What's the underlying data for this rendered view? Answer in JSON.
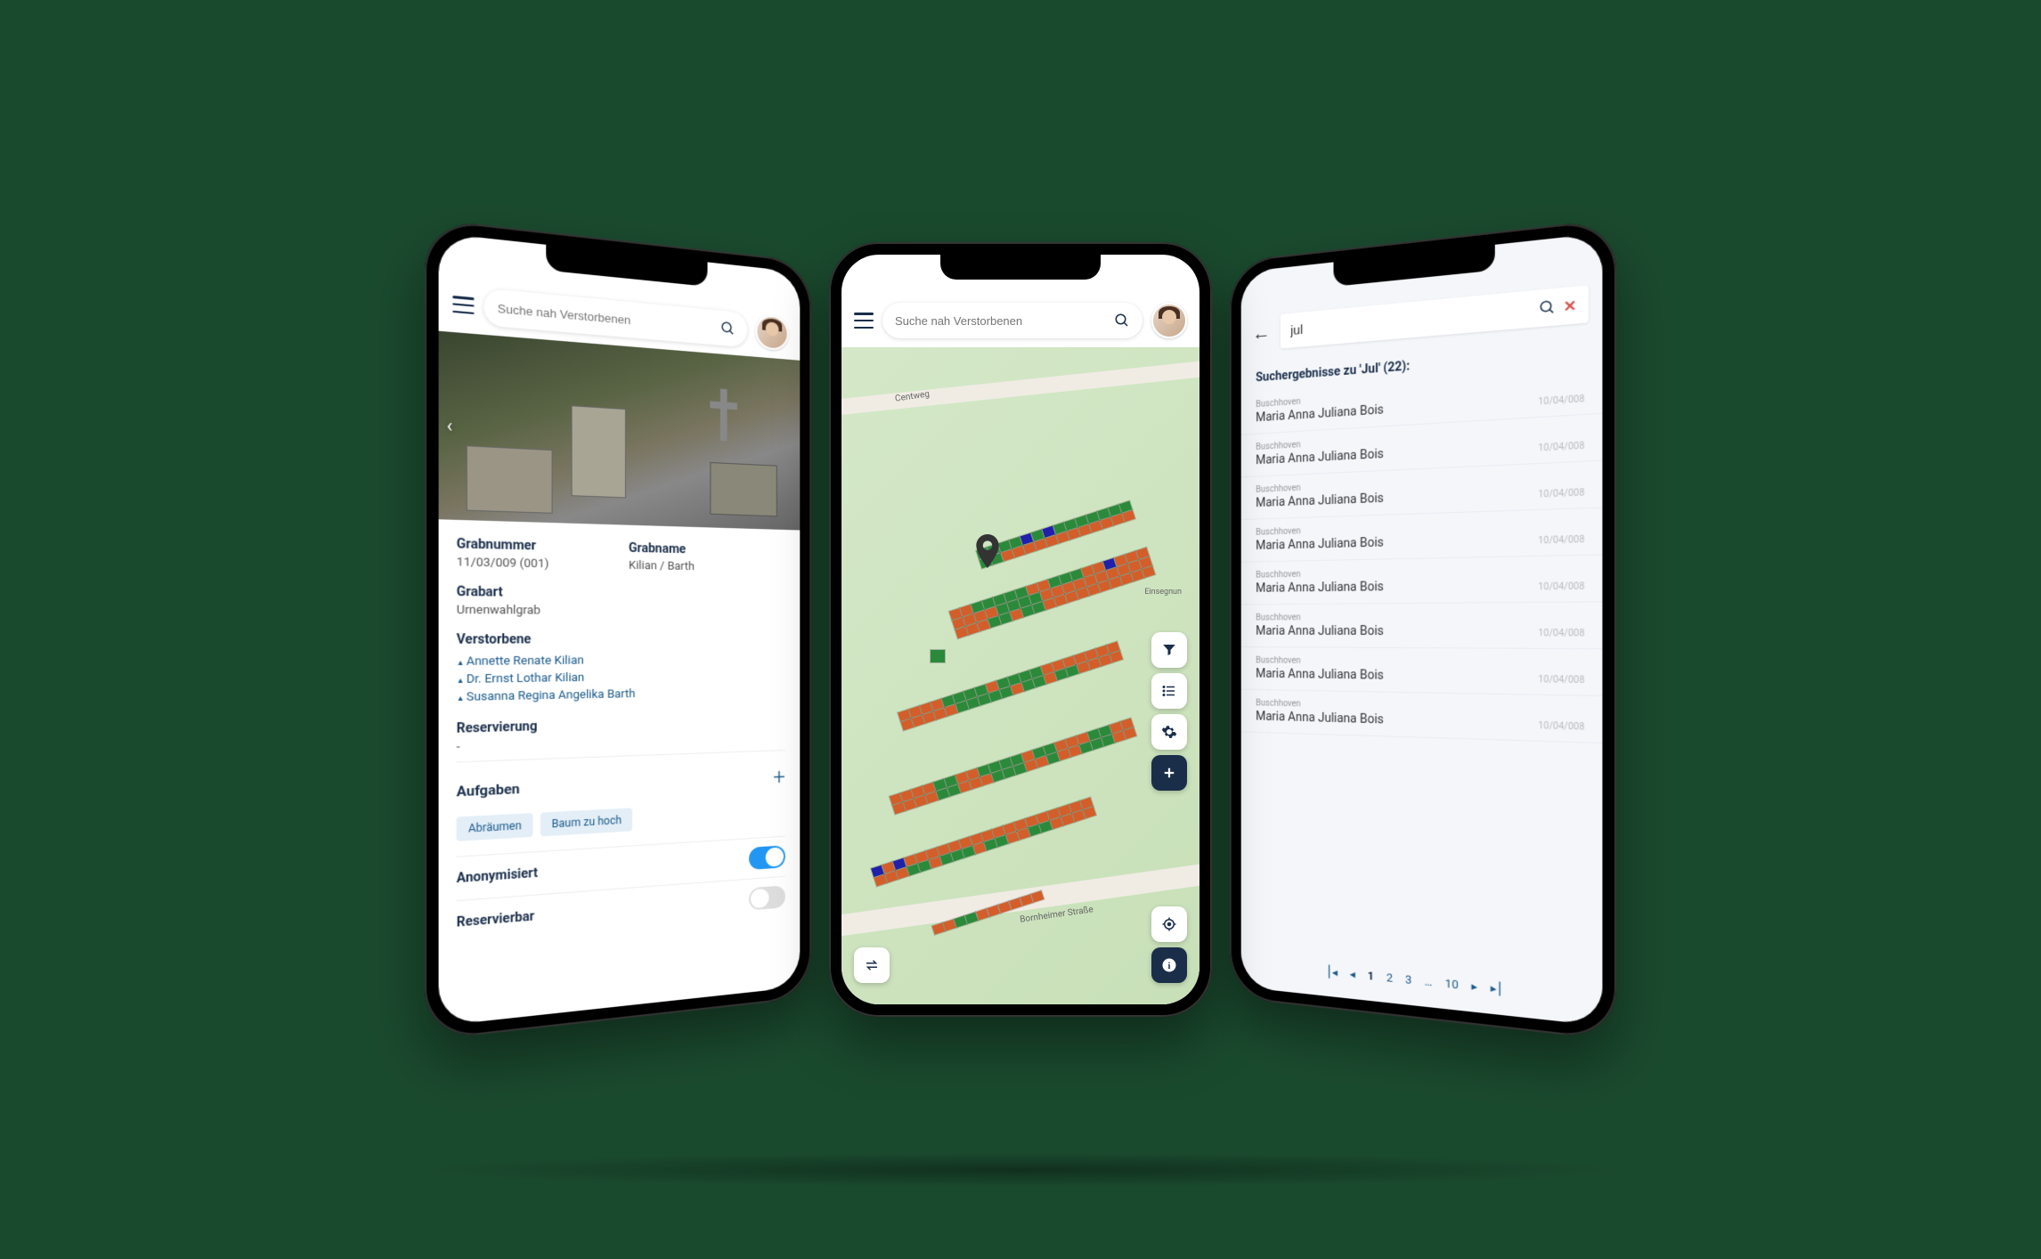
{
  "search_placeholder": "Suche nah Verstorbenen",
  "detail": {
    "grabnummer_label": "Grabnummer",
    "grabnummer_value": "11/03/009 (001)",
    "grabname_label": "Grabname",
    "grabname_value": "Kilian / Barth",
    "grabart_label": "Grabart",
    "grabart_value": "Urnenwahlgrab",
    "verstorbene_label": "Verstorbene",
    "deceased": [
      "Annette Renate Kilian",
      "Dr. Ernst Lothar Kilian",
      "Susanna Regina Angelika Barth"
    ],
    "reservierung_label": "Reservierung",
    "reservierung_value": "-",
    "aufgaben_label": "Aufgaben",
    "chips": [
      "Abräumen",
      "Baum zu hoch"
    ],
    "anonymisiert_label": "Anonymisiert",
    "reservierbar_label": "Reservierbar"
  },
  "map": {
    "street_centweg": "Centweg",
    "street_bornheimer": "Bornheimer Straße",
    "label_einsegnung": "Einsegnun"
  },
  "search": {
    "query": "jul",
    "results_title": "Suchergebnisse zu 'Jul' (22):",
    "results": [
      {
        "loc": "Buschhoven",
        "name": "Maria Anna Juliana Bois",
        "code": "10/04/008"
      },
      {
        "loc": "Buschhoven",
        "name": "Maria Anna Juliana Bois",
        "code": "10/04/008"
      },
      {
        "loc": "Buschhoven",
        "name": "Maria Anna Juliana Bois",
        "code": "10/04/008"
      },
      {
        "loc": "Buschhoven",
        "name": "Maria Anna Juliana Bois",
        "code": "10/04/008"
      },
      {
        "loc": "Buschhoven",
        "name": "Maria Anna Juliana Bois",
        "code": "10/04/008"
      },
      {
        "loc": "Buschhoven",
        "name": "Maria Anna Juliana Bois",
        "code": "10/04/008"
      },
      {
        "loc": "Buschhoven",
        "name": "Maria Anna Juliana Bois",
        "code": "10/04/008"
      },
      {
        "loc": "Buschhoven",
        "name": "Maria Anna Juliana Bois",
        "code": "10/04/008"
      }
    ],
    "pages": [
      "1",
      "2",
      "3",
      "…",
      "10"
    ]
  }
}
